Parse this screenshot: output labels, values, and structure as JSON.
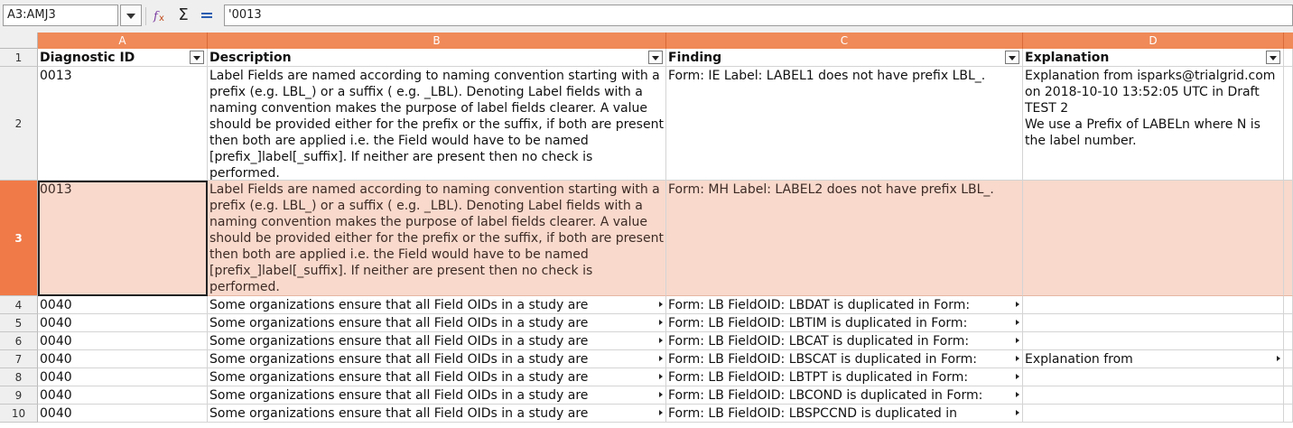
{
  "formula_bar": {
    "name_box": "A3:AMJ3",
    "formula": "'0013",
    "icons": [
      "function-wizard-icon",
      "sum-icon",
      "formula-icon"
    ]
  },
  "columns": [
    "A",
    "B",
    "C",
    "D"
  ],
  "header_row": {
    "row": "1",
    "cells": [
      "Diagnostic ID",
      "Description",
      "Finding",
      "Explanation"
    ]
  },
  "rows": [
    {
      "row": "2",
      "id": "0013",
      "description": "Label Fields are named according to naming convention starting with a prefix (e.g. LBL_) or a suffix ( e.g. _LBL). Denoting Label fields with a naming convention makes the purpose of label fields clearer. A value should be provided either for the prefix or the suffix, if both are present then both are applied i.e. the Field would have to be named [prefix_]label[_suffix]. If neither are present then no check is performed.",
      "finding": "Form: IE Label: LABEL1 does not have prefix LBL_.",
      "explanation": "Explanation from isparks@trialgrid.com on 2018-10-10 13:52:05 UTC in Draft TEST 2\nWe use a Prefix of LABELn where N is the label number."
    },
    {
      "row": "3",
      "id": "0013",
      "description": "Label Fields are named according to naming convention starting with a prefix (e.g. LBL_) or a suffix ( e.g. _LBL). Denoting Label fields with a naming convention makes the purpose of label fields clearer. A value should be provided either for the prefix or the suffix, if both are present then both are applied i.e. the Field would have to be named [prefix_]label[_suffix]. If neither are present then no check is performed.",
      "finding": "Form: MH Label: LABEL2 does not have prefix LBL_.",
      "explanation": ""
    },
    {
      "row": "4",
      "id": "0040",
      "description": "Some organizations ensure that all Field OIDs in a study are",
      "finding": "Form: LB FieldOID: LBDAT is duplicated in Form:",
      "explanation": ""
    },
    {
      "row": "5",
      "id": "0040",
      "description": "Some organizations ensure that all Field OIDs in a study are",
      "finding": "Form: LB FieldOID: LBTIM is duplicated in Form:",
      "explanation": ""
    },
    {
      "row": "6",
      "id": "0040",
      "description": "Some organizations ensure that all Field OIDs in a study are",
      "finding": "Form: LB FieldOID: LBCAT is duplicated in Form:",
      "explanation": ""
    },
    {
      "row": "7",
      "id": "0040",
      "description": "Some organizations ensure that all Field OIDs in a study are",
      "finding": "Form: LB FieldOID: LBSCAT is duplicated in Form:",
      "explanation": "Explanation from"
    },
    {
      "row": "8",
      "id": "0040",
      "description": "Some organizations ensure that all Field OIDs in a study are",
      "finding": "Form: LB FieldOID: LBTPT is duplicated in Form:",
      "explanation": ""
    },
    {
      "row": "9",
      "id": "0040",
      "description": "Some organizations ensure that all Field OIDs in a study are",
      "finding": "Form: LB FieldOID: LBCOND is duplicated in Form:",
      "explanation": ""
    },
    {
      "row": "10",
      "id": "0040",
      "description": "Some organizations ensure that all Field OIDs in a study are",
      "finding": "Form: LB FieldOID: LBSPCCND is duplicated in",
      "explanation": ""
    }
  ],
  "colors": {
    "column_header": "#f08a58",
    "selected_row_header": "#f07a48",
    "selected_row_fill": "#f8d9cc"
  }
}
